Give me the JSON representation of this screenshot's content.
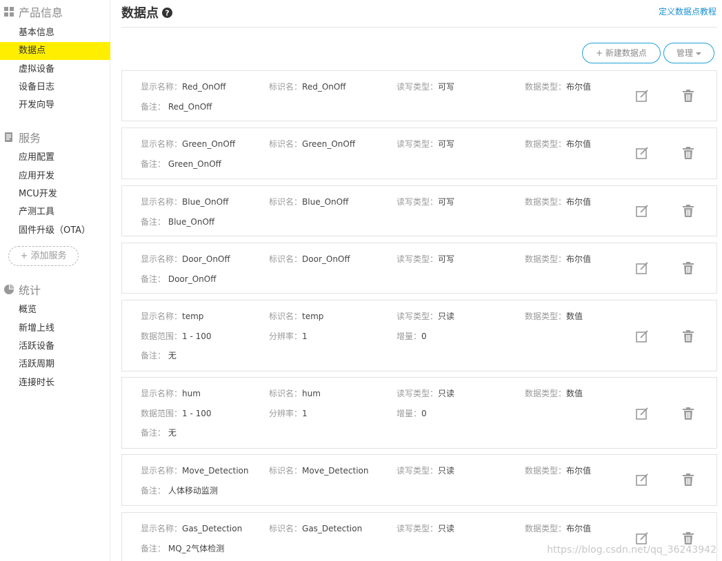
{
  "sidebar": {
    "sections": [
      {
        "title": "产品信息",
        "icon": "grid-icon",
        "items": [
          "基本信息",
          "数据点",
          "虚拟设备",
          "设备日志",
          "开发向导"
        ]
      },
      {
        "title": "服务",
        "icon": "service-icon",
        "items": [
          "应用配置",
          "应用开发",
          "MCU开发",
          "产测工具",
          "固件升级（OTA）"
        ]
      },
      {
        "title": "统计",
        "icon": "pie-chart-icon",
        "items": [
          "概览",
          "新增上线",
          "活跃设备",
          "活跃周期",
          "连接时长"
        ]
      }
    ],
    "active_item": "数据点",
    "add_service_label": "+ 添加服务"
  },
  "header": {
    "title": "数据点",
    "tutorial_link": "定义数据点教程"
  },
  "toolbar": {
    "new_label": "+ 新建数据点",
    "manage_label": "管理"
  },
  "labels": {
    "display_name": "显示名称：",
    "identifier": "标识名：",
    "rw_type": "读写类型：",
    "data_type": "数据类型：",
    "range": "数据范围：",
    "resolution": "分辨率：",
    "increment": "增量：",
    "note": "备注："
  },
  "datapoints": [
    {
      "display_name": "Red_OnOff",
      "identifier": "Red_OnOff",
      "rw_type": "可写",
      "data_type": "布尔值",
      "note": "Red_OnOff"
    },
    {
      "display_name": "Green_OnOff",
      "identifier": "Green_OnOff",
      "rw_type": "可写",
      "data_type": "布尔值",
      "note": "Green_OnOff"
    },
    {
      "display_name": "Blue_OnOff",
      "identifier": "Blue_OnOff",
      "rw_type": "可写",
      "data_type": "布尔值",
      "note": "Blue_OnOff"
    },
    {
      "display_name": "Door_OnOff",
      "identifier": "Door_OnOff",
      "rw_type": "可写",
      "data_type": "布尔值",
      "note": "Door_OnOff"
    },
    {
      "display_name": "temp",
      "identifier": "temp",
      "rw_type": "只读",
      "data_type": "数值",
      "range": "1 - 100",
      "resolution": "1",
      "increment": "0",
      "note": "无"
    },
    {
      "display_name": "hum",
      "identifier": "hum",
      "rw_type": "只读",
      "data_type": "数值",
      "range": "1 - 100",
      "resolution": "1",
      "increment": "0",
      "note": "无"
    },
    {
      "display_name": "Move_Detection",
      "identifier": "Move_Detection",
      "rw_type": "只读",
      "data_type": "布尔值",
      "note": "人体移动监测"
    },
    {
      "display_name": "Gas_Detection",
      "identifier": "Gas_Detection",
      "rw_type": "只读",
      "data_type": "布尔值",
      "note": "MQ_2气体检测"
    }
  ],
  "watermark": "https://blog.csdn.net/qq_36243942",
  "colors": {
    "accent": "#1aa2d8",
    "active_highlight": "#ffee00",
    "link": "#1a8fd0"
  }
}
